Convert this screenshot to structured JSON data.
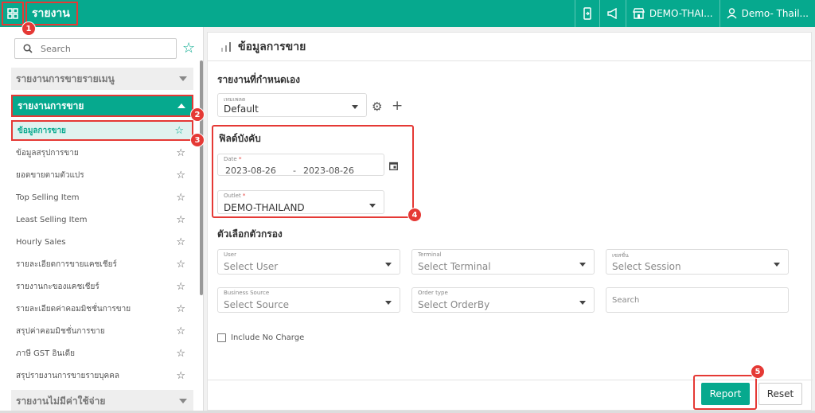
{
  "topbar": {
    "title": "รายงาน",
    "outlet": "DEMO-THAI...",
    "user": "Demo- Thail..."
  },
  "badges": [
    "1",
    "2",
    "3",
    "4",
    "5"
  ],
  "sidebar": {
    "search_placeholder": "Search",
    "sections": [
      {
        "label": "รายงานการขายรายเมนู"
      },
      {
        "label": "รายงานการขาย"
      },
      {
        "label": "รายงานไม่มีค่าใช้จ่าย"
      }
    ],
    "items": [
      {
        "label": "ข้อมูลการขาย"
      },
      {
        "label": "ข้อมูลสรุปการขาย"
      },
      {
        "label": "ยอดขายตามตัวแปร"
      },
      {
        "label": "Top Selling Item"
      },
      {
        "label": "Least Selling Item"
      },
      {
        "label": "Hourly Sales"
      },
      {
        "label": "รายละเอียดการขายแคชเชียร์"
      },
      {
        "label": "รายงานกะของแคชเชียร์"
      },
      {
        "label": "รายละเอียดค่าคอมมิชชั่นการขาย"
      },
      {
        "label": "สรุปค่าคอมมิชชั่นการขาย"
      },
      {
        "label": "ภาษี GST อินเดีย"
      },
      {
        "label": "สรุปรายงานการขายรายบุคคล"
      }
    ]
  },
  "main": {
    "title": "ข้อมูลการขาย",
    "custom_report_label": "รายงานที่กำหนดเอง",
    "template": {
      "label": "เทมเพลต",
      "value": "Default"
    },
    "required_label": "ฟิลด์บังคับ",
    "date": {
      "label": "Date",
      "required": "*",
      "start": "2023-08-26",
      "sep": "-",
      "end": "2023-08-26"
    },
    "outlet": {
      "label": "Outlet",
      "required": "*",
      "value": "DEMO-THAILAND"
    },
    "filter_label": "ตัวเลือกตัวกรอง",
    "filters": {
      "user": {
        "label": "User",
        "placeholder": "Select User"
      },
      "terminal": {
        "label": "Terminal",
        "placeholder": "Select Terminal"
      },
      "session": {
        "label": "เซสชั่น",
        "placeholder": "Select Session"
      },
      "source": {
        "label": "Business Source",
        "placeholder": "Select Source"
      },
      "order_type": {
        "label": "Order type",
        "placeholder": "Select OrderBy"
      },
      "search": {
        "placeholder": "Search"
      }
    },
    "include_no_charge": "Include No Charge",
    "report_button": "Report",
    "reset_button": "Reset"
  },
  "colors": {
    "primary": "#06a98e",
    "highlight": "#e53935"
  }
}
